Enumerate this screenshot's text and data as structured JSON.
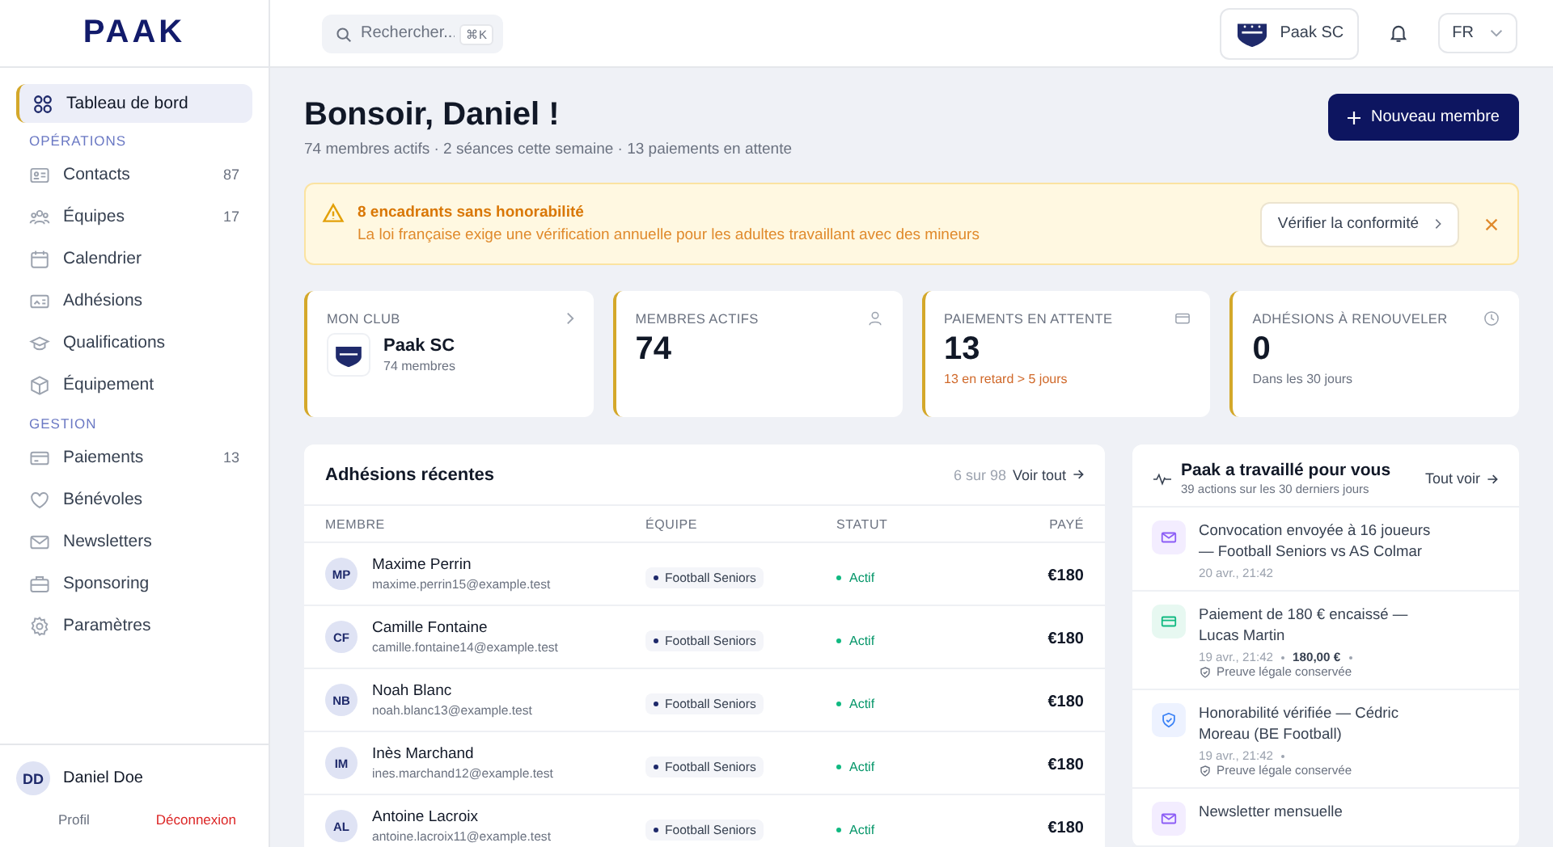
{
  "logo": "PAAK",
  "sidebar": {
    "items": [
      {
        "label": "Tableau de bord",
        "selected": true
      }
    ],
    "sections": [
      {
        "title": "OPÉRATIONS",
        "items": [
          {
            "label": "Contacts",
            "count": "87",
            "selected": false
          },
          {
            "label": "Équipes",
            "count": "17",
            "selected": false
          },
          {
            "label": "Calendrier",
            "selected": false
          },
          {
            "label": "Adhésions",
            "selected": false
          },
          {
            "label": "Qualifications",
            "selected": false
          },
          {
            "label": "Équipement",
            "selected": false
          }
        ]
      },
      {
        "title": "GESTION",
        "items": [
          {
            "label": "Paiements",
            "count": "13",
            "selected": false
          },
          {
            "label": "Bénévoles",
            "selected": false
          },
          {
            "label": "Newsletters",
            "selected": false
          },
          {
            "label": "Sponsoring",
            "selected": false
          },
          {
            "label": "Paramètres",
            "selected": false
          }
        ]
      }
    ],
    "user": {
      "initials": "DD",
      "name": "Daniel Doe",
      "links": [
        {
          "label": "Profil",
          "kind": "normal"
        },
        {
          "label": "Déconnexion",
          "kind": "danger"
        }
      ]
    }
  },
  "topbar": {
    "search": {
      "placeholder": "Rechercher...",
      "shortcut": "⌘K"
    },
    "club": "Paak SC",
    "language": "FR"
  },
  "header": {
    "title": "Bonsoir, Daniel !",
    "subtitle": "74 membres actifs · 2 séances cette semaine · 13 paiements en attente",
    "button": "Nouveau membre"
  },
  "alert": {
    "title": "8 encadrants sans honorabilité",
    "text": "La loi française exige une vérification annuelle pour les adultes travaillant avec des mineurs",
    "button": "Vérifier la conformité"
  },
  "stats": [
    {
      "kind": "club",
      "label": "MON CLUB",
      "name": "Paak SC",
      "note": "74 membres"
    },
    {
      "kind": "number",
      "label": "MEMBRES ACTIFS",
      "value": "74"
    },
    {
      "kind": "number",
      "label": "PAIEMENTS EN ATTENTE",
      "value": "13",
      "note": "13 en retard > 5 jours",
      "warning": true
    },
    {
      "kind": "number",
      "label": "ADHÉSIONS À RENOUVELER",
      "value": "0",
      "note": "Dans les 30 jours",
      "warning": false
    }
  ],
  "memberships": {
    "title": "Adhésions récentes",
    "count": "6 sur 98",
    "link": "Voir tout",
    "columns": [
      "MEMBRE",
      "ÉQUIPE",
      "STATUT",
      "PAYÉ"
    ],
    "rows": [
      {
        "initials": "MP",
        "name": "Maxime Perrin",
        "email": "maxime.perrin15@example.test",
        "team": "Football Seniors",
        "status": "Actif",
        "paid": "€180"
      },
      {
        "initials": "CF",
        "name": "Camille Fontaine",
        "email": "camille.fontaine14@example.test",
        "team": "Football Seniors",
        "status": "Actif",
        "paid": "€180"
      },
      {
        "initials": "NB",
        "name": "Noah Blanc",
        "email": "noah.blanc13@example.test",
        "team": "Football Seniors",
        "status": "Actif",
        "paid": "€180"
      },
      {
        "initials": "IM",
        "name": "Inès Marchand",
        "email": "ines.marchand12@example.test",
        "team": "Football Seniors",
        "status": "Actif",
        "paid": "€180"
      },
      {
        "initials": "AL",
        "name": "Antoine Lacroix",
        "email": "antoine.lacroix11@example.test",
        "team": "Football Seniors",
        "status": "Actif",
        "paid": "€180"
      }
    ]
  },
  "activity": {
    "title": "Paak a travaillé pour vous",
    "subtitle": "39 actions sur les 30 derniers jours",
    "link": "Tout voir",
    "items": [
      {
        "kind": "mail",
        "text": "Convocation envoyée à 16 joueurs — Football Seniors vs AS Colmar",
        "date": "20 avr., 21:42"
      },
      {
        "kind": "payment",
        "text": "Paiement de 180 € encaissé — Lucas Martin",
        "date": "19 avr., 21:42",
        "amount": "180,00 €",
        "proof": "Preuve légale conservée"
      },
      {
        "kind": "shield",
        "text": "Honorabilité vérifiée — Cédric Moreau (BE Football)",
        "date": "19 avr., 21:42",
        "proof": "Preuve légale conservée"
      },
      {
        "kind": "mail",
        "text": "Newsletter mensuelle"
      }
    ]
  }
}
